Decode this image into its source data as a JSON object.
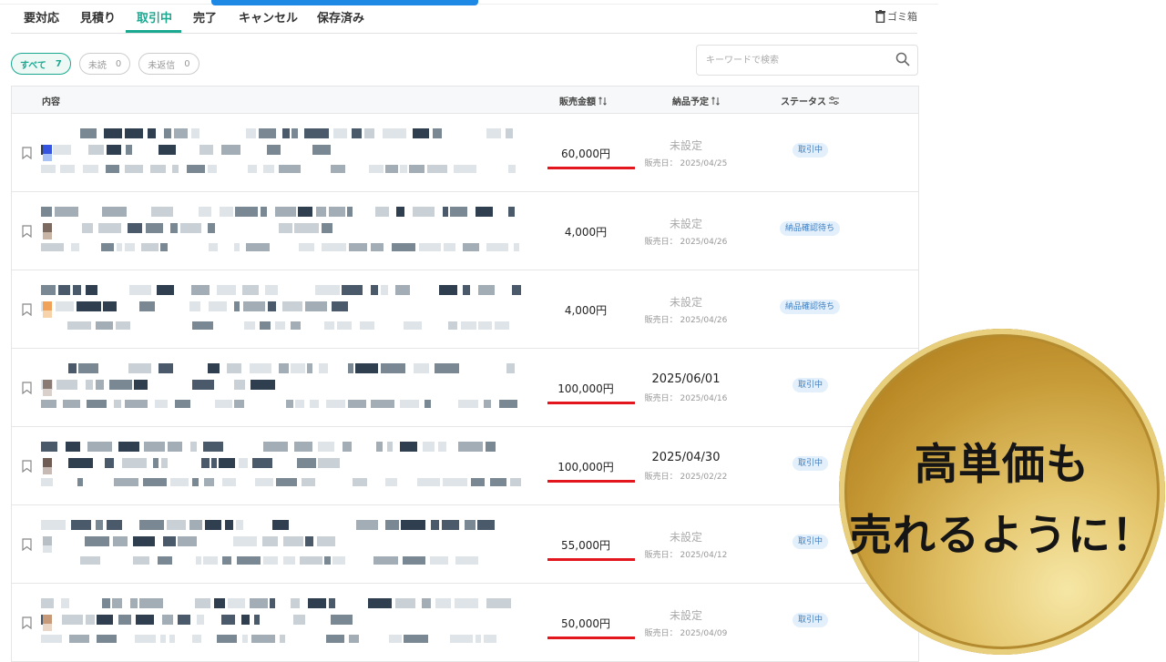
{
  "tabs": [
    {
      "label": "要対応",
      "active": false
    },
    {
      "label": "見積り",
      "active": false
    },
    {
      "label": "取引中",
      "active": true
    },
    {
      "label": "完了",
      "active": false
    },
    {
      "label": "キャンセル",
      "active": false
    },
    {
      "label": "保存済み",
      "active": false
    }
  ],
  "trash_label": "ゴミ箱",
  "filters": [
    {
      "label": "すべて",
      "count": "7",
      "active": true
    },
    {
      "label": "未読",
      "count": "0",
      "active": false
    },
    {
      "label": "未返信",
      "count": "0",
      "active": false
    }
  ],
  "search": {
    "placeholder": "キーワードで検索",
    "value": ""
  },
  "table": {
    "headers": {
      "content": "内容",
      "amount": "販売金額",
      "delivery": "納品予定",
      "status": "ステータス"
    },
    "rows": [
      {
        "amount": "60,000円",
        "highlight": true,
        "delivery": "未設定",
        "delivery_set": false,
        "sold": "販売日： 2025/04/25",
        "status": "取引中"
      },
      {
        "amount": "4,000円",
        "highlight": false,
        "delivery": "未設定",
        "delivery_set": false,
        "sold": "販売日： 2025/04/26",
        "status": "納品確認待ち"
      },
      {
        "amount": "4,000円",
        "highlight": false,
        "delivery": "未設定",
        "delivery_set": false,
        "sold": "販売日： 2025/04/26",
        "status": "納品確認待ち"
      },
      {
        "amount": "100,000円",
        "highlight": true,
        "delivery": "2025/06/01",
        "delivery_set": true,
        "sold": "販売日： 2025/04/16",
        "status": "取引中"
      },
      {
        "amount": "100,000円",
        "highlight": true,
        "delivery": "2025/04/30",
        "delivery_set": true,
        "sold": "販売日： 2025/02/22",
        "status": "取引中"
      },
      {
        "amount": "55,000円",
        "highlight": true,
        "delivery": "未設定",
        "delivery_set": false,
        "sold": "販売日： 2025/04/12",
        "status": "取引中"
      },
      {
        "amount": "50,000円",
        "highlight": true,
        "delivery": "未設定",
        "delivery_set": false,
        "sold": "販売日： 2025/04/09",
        "status": "取引中"
      }
    ]
  },
  "overlay": {
    "line1": "高単価も",
    "line2": "売れるように！"
  },
  "colors": {
    "accent": "#1aa890",
    "highlight": "#e3161d",
    "badge_bg": "#e3f0fb",
    "badge_text": "#3d7fc4"
  }
}
